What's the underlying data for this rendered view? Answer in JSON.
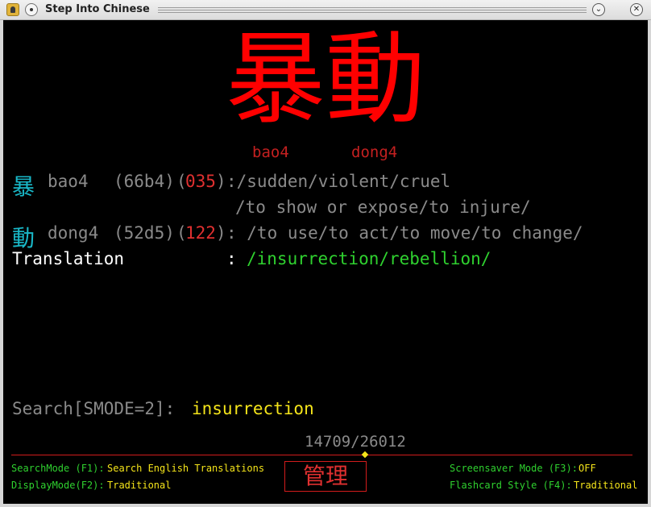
{
  "window": {
    "title": "Step Into Chinese",
    "minimize_glyph": "⌄",
    "close_glyph": "✕"
  },
  "headword": {
    "hanzi": "暴動",
    "pinyin": [
      "bao4",
      "dong4"
    ]
  },
  "characters": [
    {
      "hanzi": "暴",
      "pinyin": "bao4",
      "code": "(66b4)",
      "radical_open": "(",
      "radical": "035",
      "radical_close": ")",
      "definition_line1": ":/sudden/violent/cruel",
      "definition_line2": "/to show or expose/to injure/"
    },
    {
      "hanzi": "動",
      "pinyin": "dong4",
      "code": "(52d5)",
      "radical_open": "(",
      "radical": "122",
      "radical_close": ")",
      "definition_line1": ": /to use/to act/to move/to change/"
    }
  ],
  "translation": {
    "label": "Translation",
    "colon": ":",
    "value": "/insurrection/rebellion/"
  },
  "search": {
    "label": "Search[SMODE=2]:",
    "value": "insurrection"
  },
  "counter": "14709/26012",
  "footer": {
    "search_mode_label": "SearchMode (F1):",
    "search_mode_value": "Search English Translations",
    "display_mode_label": "DisplayMode(F2):",
    "display_mode_value": "Traditional",
    "admin_button": "管理",
    "screensaver_label": "Screensaver Mode (F3):",
    "screensaver_value": "OFF",
    "flashcard_label": "Flashcard Style (F4):",
    "flashcard_value": "Traditional"
  },
  "colors": {
    "headword": "#ff0000",
    "char_highlight": "#19b8c8",
    "translation": "#2fd12f",
    "search_value": "#f4e41a",
    "divider": "#d21c1c"
  }
}
